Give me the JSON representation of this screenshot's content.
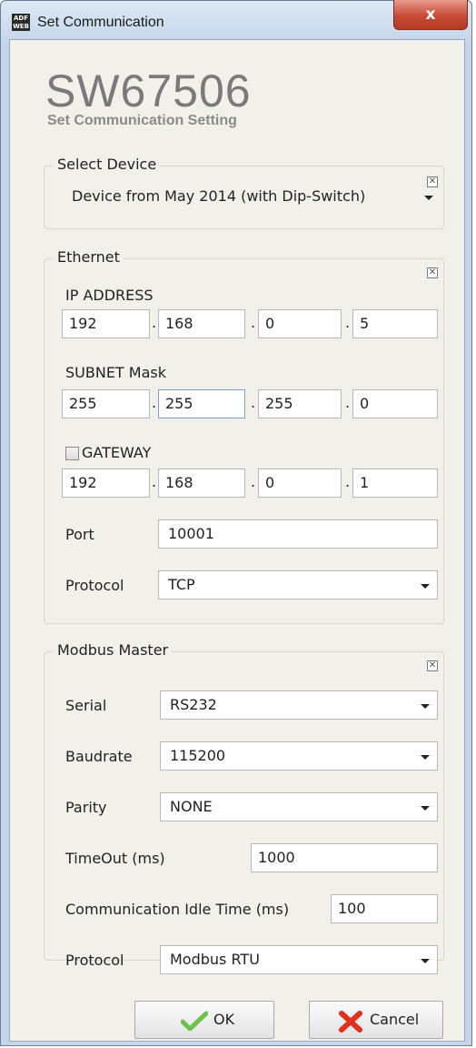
{
  "window": {
    "title": "Set Communication",
    "app_icon_text": "ADF WEB",
    "close_label": "x"
  },
  "header": {
    "product": "SW67506",
    "subtitle": "Set Communication Setting"
  },
  "select_device": {
    "legend": "Select Device",
    "device": "Device from May 2014 (with Dip-Switch)"
  },
  "ethernet": {
    "legend": "Ethernet",
    "ip_label": "IP ADDRESS",
    "ip": [
      "192",
      "168",
      "0",
      "5"
    ],
    "subnet_label": "SUBNET Mask",
    "subnet": [
      "255",
      "255",
      "255",
      "0"
    ],
    "gateway_label": "GATEWAY",
    "gateway_checked": false,
    "gateway": [
      "192",
      "168",
      "0",
      "1"
    ],
    "port_label": "Port",
    "port": "10001",
    "protocol_label": "Protocol",
    "protocol": "TCP"
  },
  "modbus": {
    "legend": "Modbus Master",
    "serial_label": "Serial",
    "serial": "RS232",
    "baud_label": "Baudrate",
    "baud": "115200",
    "parity_label": "Parity",
    "parity": "NONE",
    "timeout_label": "TimeOut (ms)",
    "timeout": "1000",
    "idle_label": "Communication Idle Time (ms)",
    "idle": "100",
    "protocol_label": "Protocol",
    "protocol": "Modbus RTU"
  },
  "buttons": {
    "ok": "OK",
    "cancel": "Cancel"
  },
  "colors": {
    "ok_check": "#6cc24a",
    "cancel_x": "#e0301e",
    "close_button": "#c84b36"
  },
  "icons": {
    "app": "adfweb-logo-icon",
    "close": "close-icon",
    "ok": "checkmark-icon",
    "cancel": "x-mark-icon",
    "collapse": "collapse-box-icon",
    "dropdown": "chevron-down-icon"
  }
}
